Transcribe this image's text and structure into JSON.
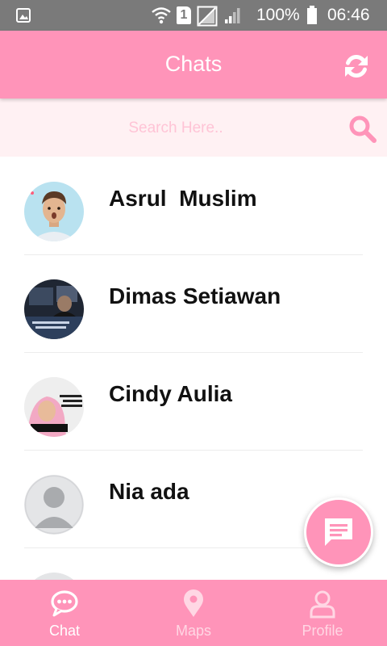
{
  "status_bar": {
    "battery": "100%",
    "time": "06:46",
    "sim_slot": "1",
    "icons": [
      "gallery-icon",
      "wifi-icon",
      "sim-icon",
      "no-sim-icon",
      "signal-icon",
      "battery-icon"
    ]
  },
  "app_bar": {
    "title": "Chats",
    "refresh_icon": "refresh-icon"
  },
  "search": {
    "placeholder": "Search Here..",
    "value": "",
    "icon": "search-icon"
  },
  "chats": [
    {
      "name": "Asrul  Muslim",
      "avatar": "photo"
    },
    {
      "name": "Dimas Setiawan",
      "avatar": "photo"
    },
    {
      "name": "Cindy Aulia",
      "avatar": "photo"
    },
    {
      "name": "Nia ada",
      "avatar": "default"
    }
  ],
  "fab": {
    "icon": "message-icon"
  },
  "bottom_nav": {
    "items": [
      {
        "label": "Chat",
        "icon": "chat-icon",
        "active": true
      },
      {
        "label": "Maps",
        "icon": "map-pin-icon",
        "active": false
      },
      {
        "label": "Profile",
        "icon": "person-icon",
        "active": false
      }
    ]
  },
  "colors": {
    "primary": "#ff94b9",
    "search_background": "#fff1f3",
    "status_bar": "#7a7a7a"
  }
}
